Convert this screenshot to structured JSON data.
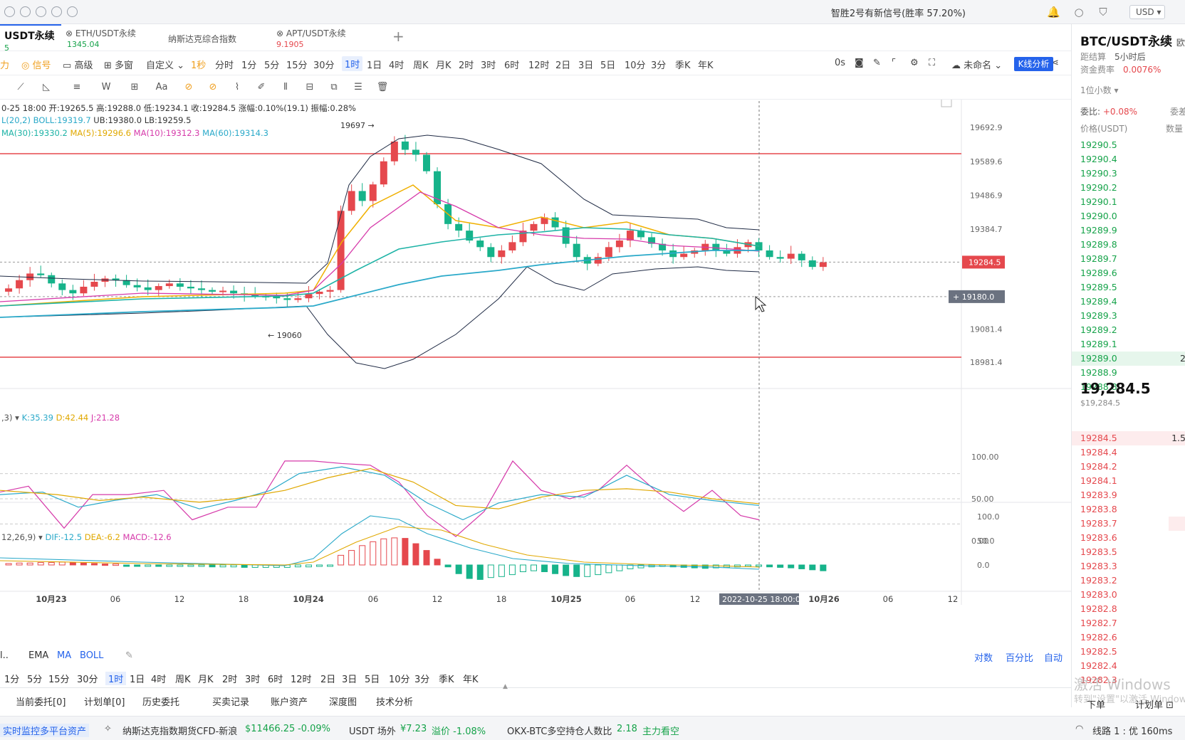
{
  "topbar": {
    "signal": "智胜2号有新信号(胜率 57.20%)",
    "currency": "USD"
  },
  "tabs": [
    {
      "name": "USDT永续",
      "value": "5",
      "active": true
    },
    {
      "name": "ETH/USDT永续",
      "value": "1345.04"
    },
    {
      "name": "纳斯达克综合指数",
      "value": ""
    },
    {
      "name": "APT/USDT永续",
      "value": "9.1905"
    }
  ],
  "toolbar": {
    "left": [
      "力",
      "信号",
      "高级",
      "多窗",
      "自定义"
    ],
    "intervals": [
      "1秒",
      "分时",
      "1分",
      "5分",
      "15分",
      "30分",
      "1时",
      "1日",
      "4时",
      "周K",
      "月K",
      "2时",
      "3时",
      "6时",
      "12时",
      "2日",
      "3日",
      "5日",
      "10分",
      "3分",
      "季K",
      "年K"
    ],
    "selected": "1时",
    "timer": "0s",
    "layout_name": "未命名",
    "k_analysis": "K线分析"
  },
  "legend": {
    "ohlc": "0-25 18:00  开:19265.5  高:19288.0  低:19234.1  收:19284.5  涨幅:0.10%(19.1)  振幅:0.28%",
    "boll_params": "L(20,2)",
    "boll": "BOLL:19319.7",
    "ub": "UB:19380.0",
    "lb": "LB:19259.5",
    "ma30": "MA(30):19330.2",
    "ma5": "MA(5):19296.6",
    "ma10": "MA(10):19312.3",
    "ma60": "MA(60):19314.3",
    "kdj_params": ",3)",
    "k": "K:35.39",
    "d": "D:42.44",
    "j": "J:21.28",
    "macd_params": "12,26,9)",
    "dif": "DIF:-12.5",
    "dea": "DEA:-6.2",
    "macd": "MACD:-12.6"
  },
  "chart_data": {
    "type": "candlestick",
    "price_axis": [
      "19692.9",
      "19589.6",
      "19486.9",
      "19384.7",
      "19284.5",
      "19180.0",
      "19081.4",
      "18981.4"
    ],
    "kdj_axis": [
      "100.00",
      "50.00",
      "0.00"
    ],
    "macd_axis": [
      "100.0",
      "50.0",
      "0.0"
    ],
    "time_axis": [
      "10月23",
      "06",
      "12",
      "18",
      "10月24",
      "06",
      "12",
      "18",
      "10月25",
      "06",
      "12",
      "2022-10-25 18:00:00",
      "10月26",
      "06",
      "12"
    ],
    "high_marker": "19697",
    "low_marker": "19060",
    "last_price": "19284.5",
    "cursor_price": "19180.0"
  },
  "bottom_tools": {
    "indicators": [
      "EMA",
      "MA",
      "BOLL"
    ],
    "intervals2": [
      "1分",
      "5分",
      "15分",
      "30分",
      "1时",
      "1日",
      "4时",
      "周K",
      "月K",
      "2时",
      "3时",
      "6时",
      "12时",
      "2日",
      "3日",
      "5日",
      "10分",
      "3分",
      "季K",
      "年K"
    ],
    "scale_modes": [
      "对数",
      "百分比",
      "自动"
    ],
    "order_tabs": [
      "当前委托[0]",
      "计划单[0]",
      "历史委托",
      "买卖记录",
      "账户资产",
      "深度图",
      "技术分析"
    ]
  },
  "right_panel": {
    "title": "BTC/USDT永续",
    "title_suffix": "欧易",
    "settle_label": "距结算",
    "settle_value": "5小时后",
    "funding_label": "资金费率",
    "funding_value": "0.0076%",
    "decimals": "1位小数",
    "weibi_label": "委比:",
    "weibi_value": "+0.08%",
    "weicha_label": "委差",
    "price_header": "价格(USDT)",
    "qty_header": "数量",
    "asks": [
      "19290.5",
      "19290.4",
      "19290.3",
      "19290.2",
      "19290.1",
      "19290.0",
      "19289.9",
      "19289.8",
      "19289.7",
      "19289.6",
      "19289.5",
      "19289.4",
      "19289.3",
      "19289.2",
      "19289.1",
      "19289.0",
      "19288.9",
      "19288.8"
    ],
    "ask_highlight_vol": "2",
    "last_price": "19,284.5",
    "last_usd": "$19,284.5",
    "bids": [
      "19284.5",
      "19284.4",
      "19284.2",
      "19284.1",
      "19283.9",
      "19283.8",
      "19283.7",
      "19283.6",
      "19283.5",
      "19283.3",
      "19283.2",
      "19283.0",
      "19282.8",
      "19282.7",
      "19282.6",
      "19282.5",
      "19282.4",
      "19282.3"
    ],
    "bid_highlight_vol": "1.5",
    "order_btn": "下单",
    "plan_btn": "计划单"
  },
  "status": {
    "monitor": "实时监控多平台资产",
    "nasdaq_label": "纳斯达克指数期货CFD-新浪",
    "nasdaq_value": "$11466.25",
    "nasdaq_change": "-0.09%",
    "usdt_label": "USDT 场外",
    "usdt_value": "¥7.23",
    "usdt_premium": "溢价 -1.08%",
    "okx_label": "OKX-BTC多空持仓人数比",
    "okx_value": "2.18",
    "okx_side": "主力看空",
    "line": "线路 1 : 优 160ms"
  },
  "watermark": {
    "line1": "激活 Windows",
    "line2": "转到\"设置\"以激活 Windows。"
  }
}
